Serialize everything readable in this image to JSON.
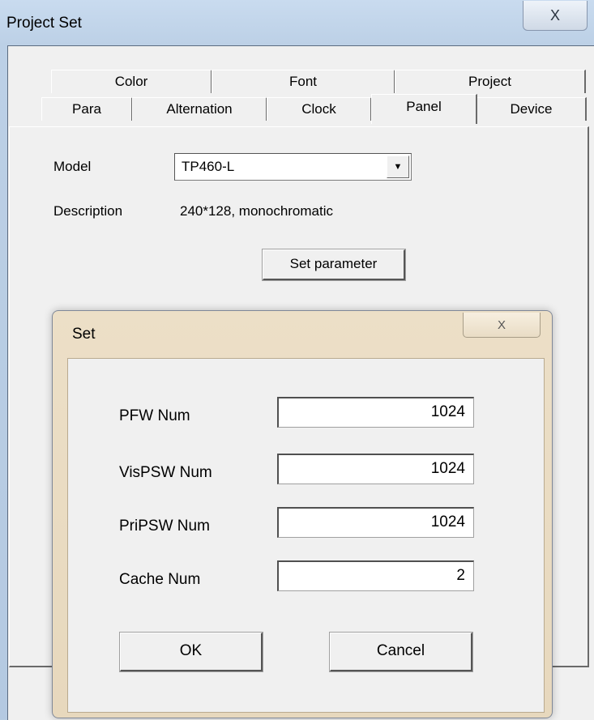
{
  "window": {
    "title": "Project Set",
    "close_glyph": "X"
  },
  "tabs": {
    "back_row": [
      "Color",
      "Font",
      "Project"
    ],
    "front_row": [
      "Para",
      "Alternation",
      "Clock",
      "Panel",
      "Device"
    ],
    "active": "Panel"
  },
  "panel": {
    "model_label": "Model",
    "model_value": "TP460-L",
    "description_label": "Description",
    "description_value": "240*128, monochromatic",
    "set_parameter_label": "Set parameter"
  },
  "dialog": {
    "title": "Set",
    "close_glyph": "X",
    "fields": [
      {
        "label": "PFW Num",
        "value": "1024"
      },
      {
        "label": "VisPSW Num",
        "value": "1024"
      },
      {
        "label": "PriPSW Num",
        "value": "1024"
      },
      {
        "label": "Cache Num",
        "value": "2"
      }
    ],
    "ok_label": "OK",
    "cancel_label": "Cancel"
  }
}
